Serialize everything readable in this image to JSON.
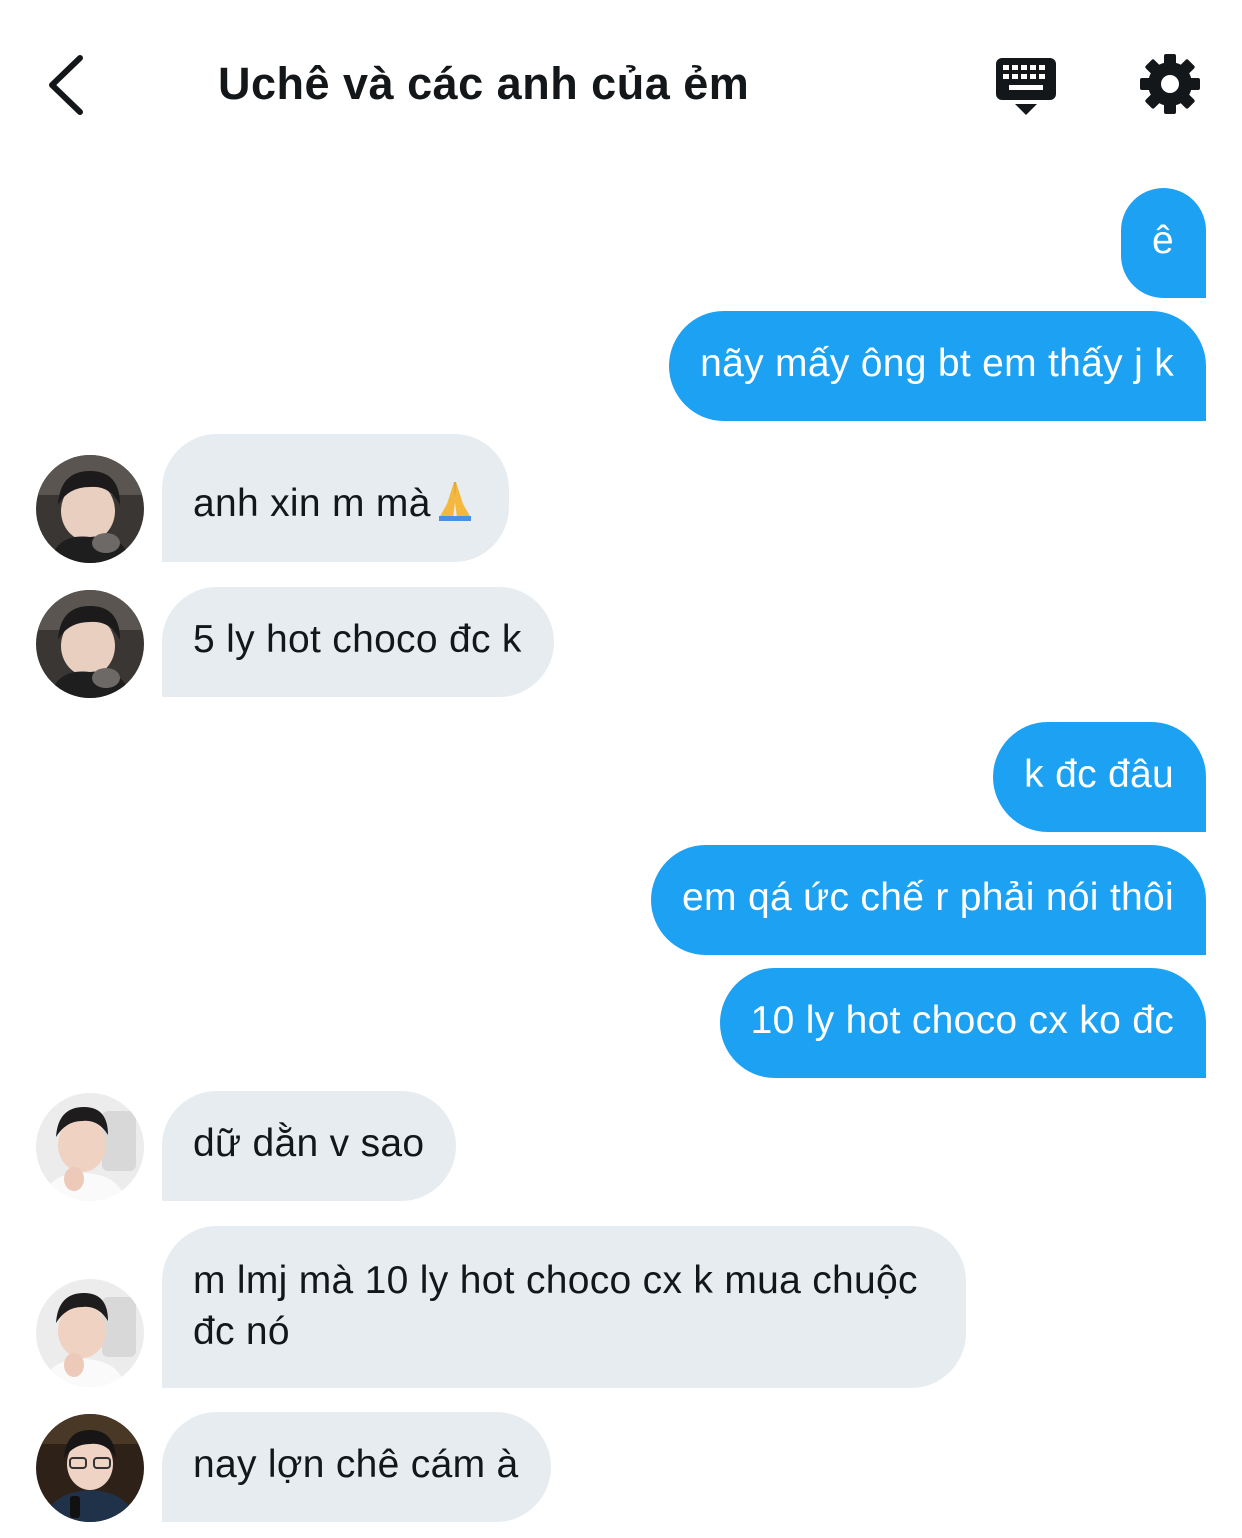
{
  "header": {
    "title": "Uchê và các anh của ẻm",
    "back_icon": "chevron-left-icon",
    "keyboard_icon": "keyboard-icon",
    "settings_icon": "gear-icon"
  },
  "colors": {
    "outgoing_bubble": "#1da1f2",
    "incoming_bubble": "#e6ecf0",
    "text": "#14171a"
  },
  "messages": [
    {
      "direction": "out",
      "text": "ê"
    },
    {
      "direction": "out",
      "text": "nãy mấy ông bt em thấy j k"
    },
    {
      "direction": "in",
      "text": "anh xin m mà",
      "emoji": "folded-hands-icon"
    },
    {
      "direction": "in",
      "text": "5 ly hot choco đc k"
    },
    {
      "direction": "out",
      "text": "k đc đâu"
    },
    {
      "direction": "out",
      "text": "em qá ức chế r phải nói thôi"
    },
    {
      "direction": "out",
      "text": "10 ly hot choco cx ko đc"
    },
    {
      "direction": "in",
      "text": "dữ dằn v sao"
    },
    {
      "direction": "in",
      "text": "m lmj mà 10 ly hot choco cx k mua chuộc đc nó"
    },
    {
      "direction": "in",
      "text": "nay lợn chê cám à"
    }
  ]
}
